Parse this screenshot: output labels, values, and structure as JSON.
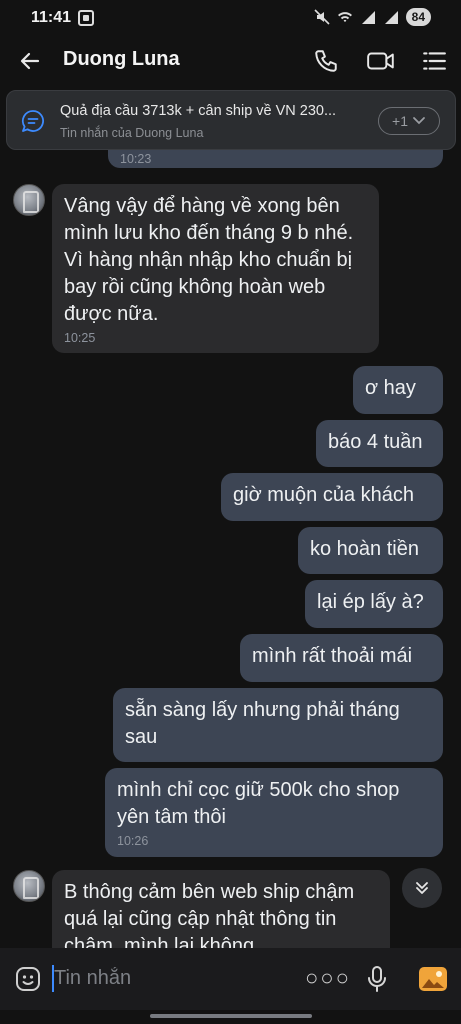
{
  "status_bar": {
    "time": "11:41",
    "battery": "84"
  },
  "header": {
    "contact_name": "Duong Luna"
  },
  "pinned": {
    "text": "Quả địa cầu 3713k + cân ship về VN 230...",
    "subtitle": "Tin nhắn của Duong Luna",
    "more_label": "+1"
  },
  "messages": [
    {
      "id": "m0",
      "direction": "out",
      "text": "",
      "time": "10:23"
    },
    {
      "id": "m1",
      "direction": "in",
      "text": "Vâng vậy để hàng về xong bên mình lưu kho đến tháng 9 b nhé. Vì hàng nhận nhập kho chuẩn bị bay rồi cũng không hoàn web được nữa.",
      "time": "10:25"
    },
    {
      "id": "m2",
      "direction": "out",
      "text": "ơ hay",
      "time": ""
    },
    {
      "id": "m3",
      "direction": "out",
      "text": "báo 4 tuần",
      "time": ""
    },
    {
      "id": "m4",
      "direction": "out",
      "text": "giờ muộn của khách",
      "time": ""
    },
    {
      "id": "m5",
      "direction": "out",
      "text": "ko hoàn tiền",
      "time": ""
    },
    {
      "id": "m6",
      "direction": "out",
      "text": "lại ép lấy à?",
      "time": ""
    },
    {
      "id": "m7",
      "direction": "out",
      "text": "mình rất thoải mái",
      "time": ""
    },
    {
      "id": "m8",
      "direction": "out",
      "text": "sẵn sàng lấy nhưng phải tháng sau",
      "time": ""
    },
    {
      "id": "m9",
      "direction": "out",
      "text": "mình chỉ cọc giữ 500k cho shop yên tâm thôi",
      "time": "10:26"
    },
    {
      "id": "m10",
      "direction": "in",
      "text": "B thông cảm bên web ship chậm quá lại cũng cập nhật thông tin chậm, mình lại không",
      "time": ""
    }
  ],
  "composer": {
    "placeholder": "Tin nhắn"
  }
}
